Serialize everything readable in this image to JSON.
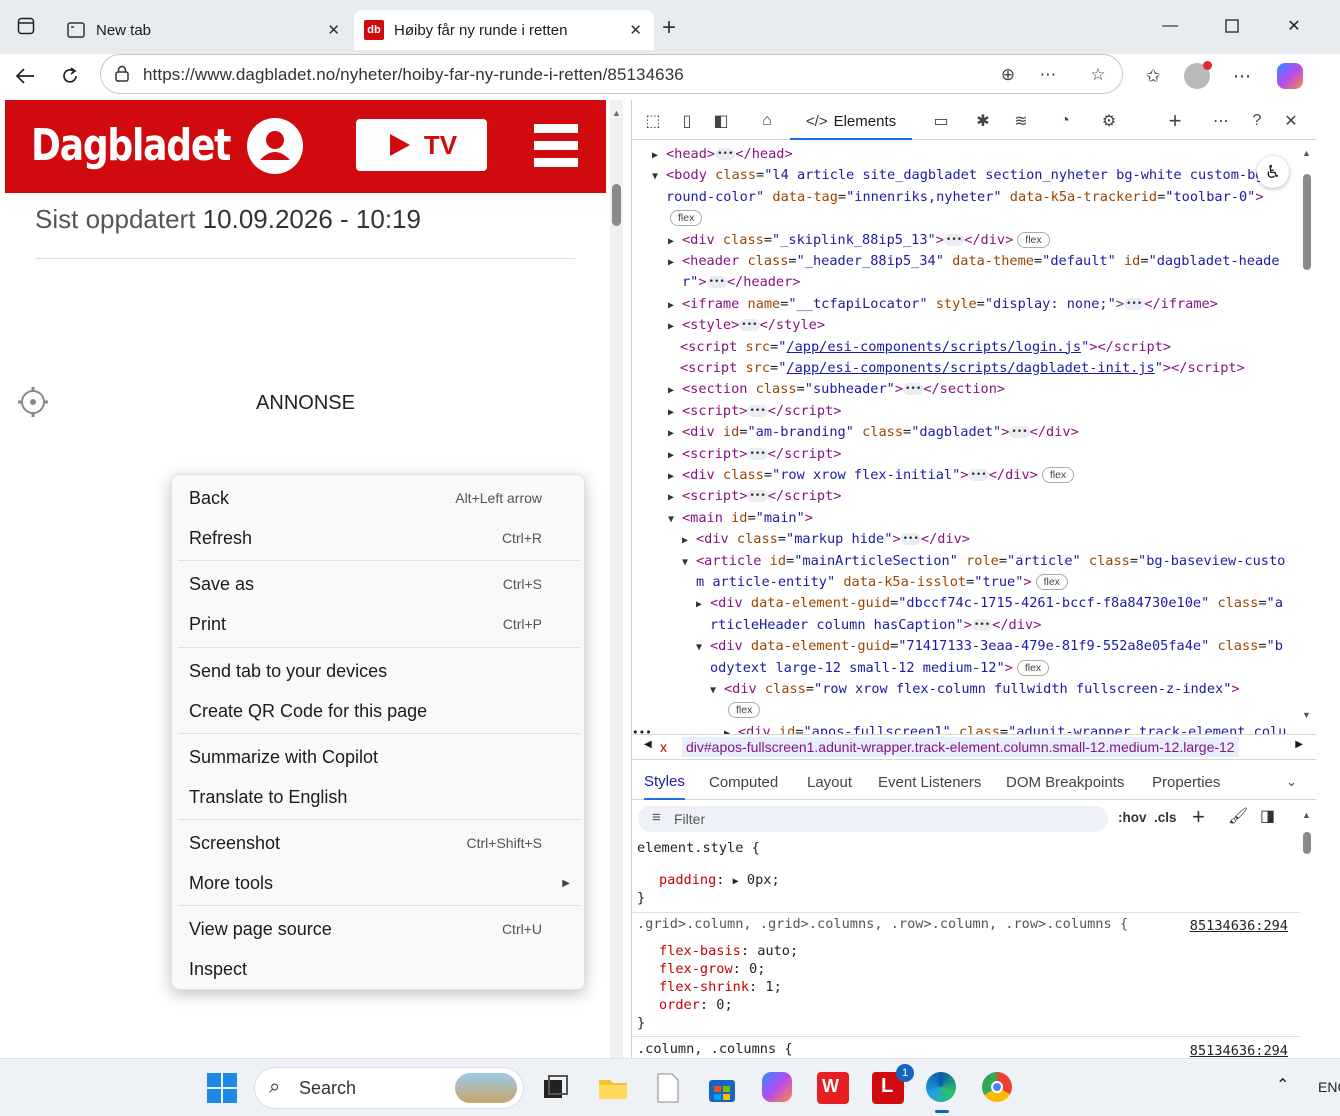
{
  "browser": {
    "tabs": [
      {
        "title": "New tab",
        "active": false
      },
      {
        "title": "Høiby får ny runde i retten",
        "active": true,
        "favicon_text": "db"
      }
    ],
    "url": "https://www.dagbladet.no/nyheter/hoiby-far-ny-runde-i-retten/85134636"
  },
  "page": {
    "logo": "Dagbladet",
    "tv_label": "TV",
    "updated_label": "Sist oppdatert",
    "updated_value": "10.09.2026 - 10:19",
    "ad_label": "ANNONSE"
  },
  "context_menu": {
    "items": [
      {
        "label": "Back",
        "shortcut": "Alt+Left arrow"
      },
      {
        "label": "Refresh",
        "shortcut": "Ctrl+R"
      },
      {
        "label": "Save as",
        "shortcut": "Ctrl+S"
      },
      {
        "label": "Print",
        "shortcut": "Ctrl+P"
      },
      {
        "label": "Send tab to your devices",
        "shortcut": ""
      },
      {
        "label": "Create QR Code for this page",
        "shortcut": ""
      },
      {
        "label": "Summarize with Copilot",
        "shortcut": ""
      },
      {
        "label": "Translate to English",
        "shortcut": ""
      },
      {
        "label": "Screenshot",
        "shortcut": "Ctrl+Shift+S"
      },
      {
        "label": "More tools",
        "shortcut": ""
      },
      {
        "label": "View page source",
        "shortcut": "Ctrl+U"
      },
      {
        "label": "Inspect",
        "shortcut": ""
      }
    ]
  },
  "devtools": {
    "active_tab": "Elements",
    "breadcrumb": "div#apos-fullscreen1.adunit-wrapper.track-element.column.small-12.medium-12.large-12",
    "breadcrumb_x": "x",
    "subtabs": [
      "Styles",
      "Computed",
      "Layout",
      "Event Listeners",
      "DOM Breakpoints",
      "Properties"
    ],
    "filter_placeholder": "Filter",
    "filter_hov": ":hov",
    "filter_cls": ".cls",
    "badge_flex": "flex"
  },
  "styles_pane": {
    "element_style_selector": "element.style {",
    "padding_prop": "padding",
    "padding_val": "0px;",
    "close": "}",
    "rule2_selector": ".grid>.column, .grid>.columns, .row>.column, .row>.columns {",
    "rule2_source": "85134636:294",
    "rule2_props": [
      {
        "name": "flex-basis",
        "value": "auto;"
      },
      {
        "name": "flex-grow",
        "value": "0;"
      },
      {
        "name": "flex-shrink",
        "value": "1;"
      },
      {
        "name": "order",
        "value": "0;"
      }
    ],
    "rule3_selector": ".column, .columns {",
    "rule3_source": "85134636:294"
  },
  "taskbar": {
    "search_label": "Search",
    "language": "ENG",
    "notification_count": "1"
  }
}
